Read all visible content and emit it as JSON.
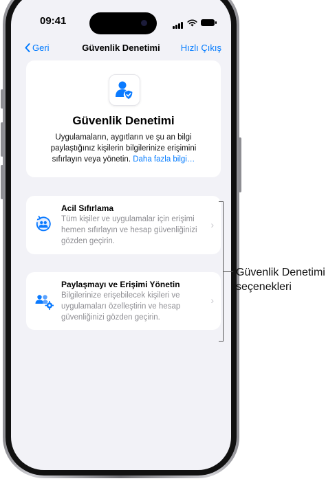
{
  "status_bar": {
    "time": "09:41"
  },
  "nav": {
    "back_label": "Geri",
    "title": "Güvenlik Denetimi",
    "exit_label": "Hızlı Çıkış"
  },
  "header_card": {
    "title": "Güvenlik Denetimi",
    "description": "Uygulamaların, aygıtların ve şu an bilgi paylaştığınız kişilerin bilgilerinize erişimini sıfırlayın veya yönetin.",
    "link": "Daha fazla bilgi…"
  },
  "options": [
    {
      "title": "Acil Sıfırlama",
      "description": "Tüm kişiler ve uygulamalar için erişimi hemen sıfırlayın ve hesap güvenliğinizi gözden geçirin.",
      "icon": "emergency-reset-icon"
    },
    {
      "title": "Paylaşmayı ve Erişimi Yönetin",
      "description": "Bilgilerinize erişebilecek kişileri ve uygulamaları özelleştirin ve hesap güvenliğinizi gözden geçirin.",
      "icon": "manage-sharing-icon"
    }
  ],
  "callout": {
    "text": "Güvenlik Denetimi seçenekleri"
  },
  "colors": {
    "accent": "#007aff",
    "background": "#f2f2f7",
    "icon_bg": "#e7f0fb"
  }
}
